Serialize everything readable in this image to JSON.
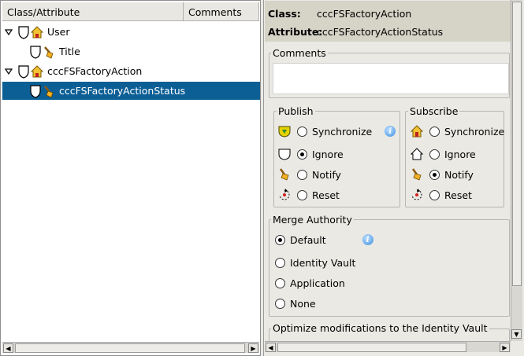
{
  "tree": {
    "columns": [
      "Class/Attribute",
      "Comments"
    ],
    "rows": [
      {
        "label": "User",
        "icon": "class-shield-house-icon",
        "expanded": true
      },
      {
        "label": "Title",
        "icon": "attribute-shield-brush-icon"
      },
      {
        "label": "cccFSFactoryAction",
        "icon": "class-shield-house-icon",
        "expanded": true
      },
      {
        "label": "cccFSFactoryActionStatus",
        "icon": "attribute-shield-brush-icon",
        "selected": true
      }
    ]
  },
  "details": {
    "class_label": "Class:",
    "class_value": "cccFSFactoryAction",
    "attribute_label": "Attribute:",
    "attribute_value": "cccFSFactoryActionStatus",
    "comments_title": "Comments",
    "comments_value": ""
  },
  "publish": {
    "title": "Publish",
    "options": [
      {
        "label": "Synchronize",
        "icon": "sync-down-arrow-icon",
        "selected": false
      },
      {
        "label": "Ignore",
        "icon": "shield-ignore-icon",
        "selected": true
      },
      {
        "label": "Notify",
        "icon": "brush-notify-icon",
        "selected": false
      },
      {
        "label": "Reset",
        "icon": "reset-arrow-icon",
        "selected": false
      }
    ]
  },
  "subscribe": {
    "title": "Subscribe",
    "options": [
      {
        "label": "Synchronize",
        "icon": "sync-house-icon",
        "selected": false
      },
      {
        "label": "Ignore",
        "icon": "house-outline-icon",
        "selected": false
      },
      {
        "label": "Notify",
        "icon": "brush-notify-icon",
        "selected": true
      },
      {
        "label": "Reset",
        "icon": "reset-arrow-icon",
        "selected": false
      }
    ]
  },
  "merge": {
    "title": "Merge Authority",
    "options": [
      {
        "label": "Default",
        "selected": true
      },
      {
        "label": "Identity Vault",
        "selected": false
      },
      {
        "label": "Application",
        "selected": false
      },
      {
        "label": "None",
        "selected": false
      }
    ]
  },
  "optimize": {
    "title": "Optimize modifications to the Identity Vault"
  },
  "colors": {
    "selection": "#0c5f95",
    "info_background": "#d6d4c7",
    "panel_background": "#ebe9e4"
  }
}
